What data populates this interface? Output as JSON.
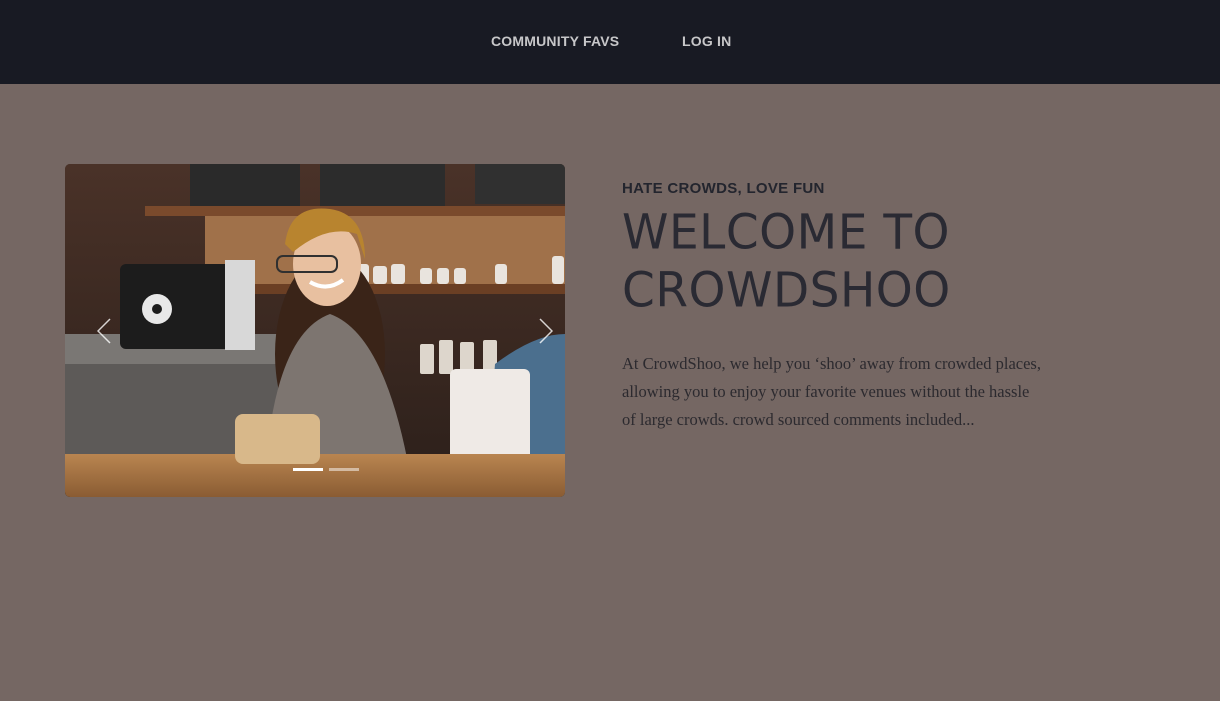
{
  "nav": {
    "links": [
      {
        "label": "COMMUNITY FAVS"
      },
      {
        "label": "LOG IN"
      }
    ],
    "background": "#181a23"
  },
  "carousel": {
    "image_description": "",
    "prev_icon": "chevron-left-icon",
    "next_icon": "chevron-right-icon",
    "slides_count": 2,
    "active_slide": 1
  },
  "intro": {
    "kicker": "HATE CROWDS, LOVE FUN",
    "headline_lines": [
      "WELCOME TO",
      "CROWDSHOO"
    ],
    "body": "At CrowdShoo, we help you ‘shoo’ away from crowded places, allowing you to enjoy your favorite venues without the hassle of large crowds. crowd sourced comments included..."
  },
  "colors": {
    "page_background": "#756763",
    "text_dark": "#2a2a33"
  }
}
